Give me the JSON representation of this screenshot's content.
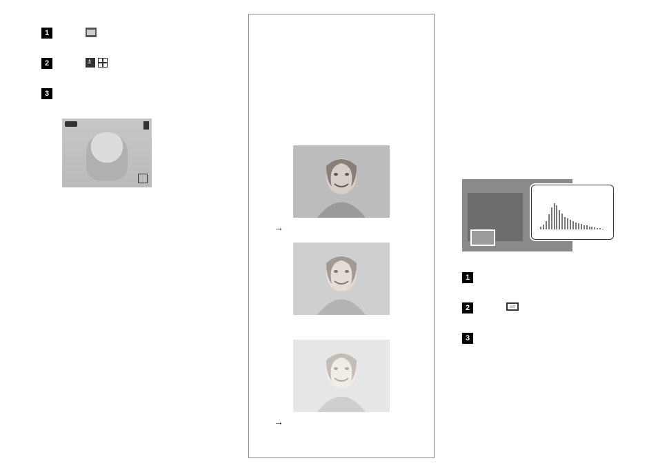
{
  "left_steps": {
    "s1": "1",
    "s2": "2",
    "s3": "3"
  },
  "mid": {
    "arrow1": "→",
    "arrow2": "→"
  },
  "right_steps": {
    "s1": "1",
    "s2": "2",
    "s3": "3"
  },
  "thumb_brightness": {
    "a": 1.0,
    "b": 1.18,
    "c": 1.42
  }
}
